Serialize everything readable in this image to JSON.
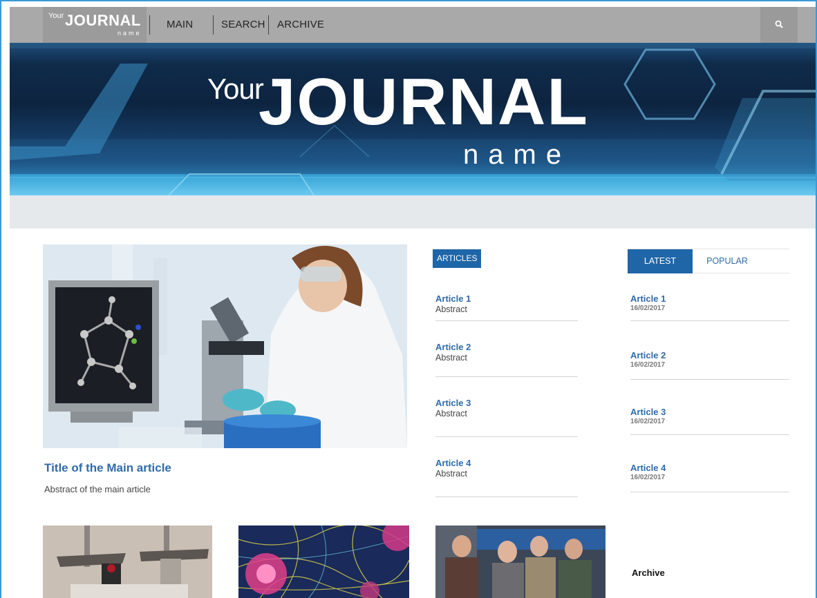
{
  "nav": {
    "logo": {
      "your": "Your",
      "journal": "JOURNAL",
      "name": "name"
    },
    "links": [
      "MAIN",
      "SEARCH",
      "ARCHIVE"
    ],
    "search_icon": "search-icon"
  },
  "banner": {
    "your": "Your",
    "journal": "JOURNAL",
    "name": "name"
  },
  "main_article": {
    "title": "Title of the Main article",
    "abstract": "Abstract of the main article"
  },
  "articles": {
    "tag": "ARTICLES",
    "items": [
      {
        "title": "Article 1",
        "abstract": "Abstract"
      },
      {
        "title": "Article 2",
        "abstract": "Abstract"
      },
      {
        "title": "Article 3",
        "abstract": "Abstract"
      },
      {
        "title": "Article 4",
        "abstract": "Abstract"
      }
    ]
  },
  "sidebar": {
    "tabs": [
      "LATEST",
      "POPULAR"
    ],
    "items": [
      {
        "title": "Article 1",
        "date": "16/02/2017"
      },
      {
        "title": "Article 2",
        "date": "16/02/2017"
      },
      {
        "title": "Article 3",
        "date": "16/02/2017"
      },
      {
        "title": "Article 4",
        "date": "16/02/2017"
      }
    ],
    "archive": "Archive"
  },
  "colors": {
    "accent": "#1f66a8",
    "link": "#2f6aa8",
    "nav": "#a9a9a9",
    "banner": "#0d2440"
  }
}
